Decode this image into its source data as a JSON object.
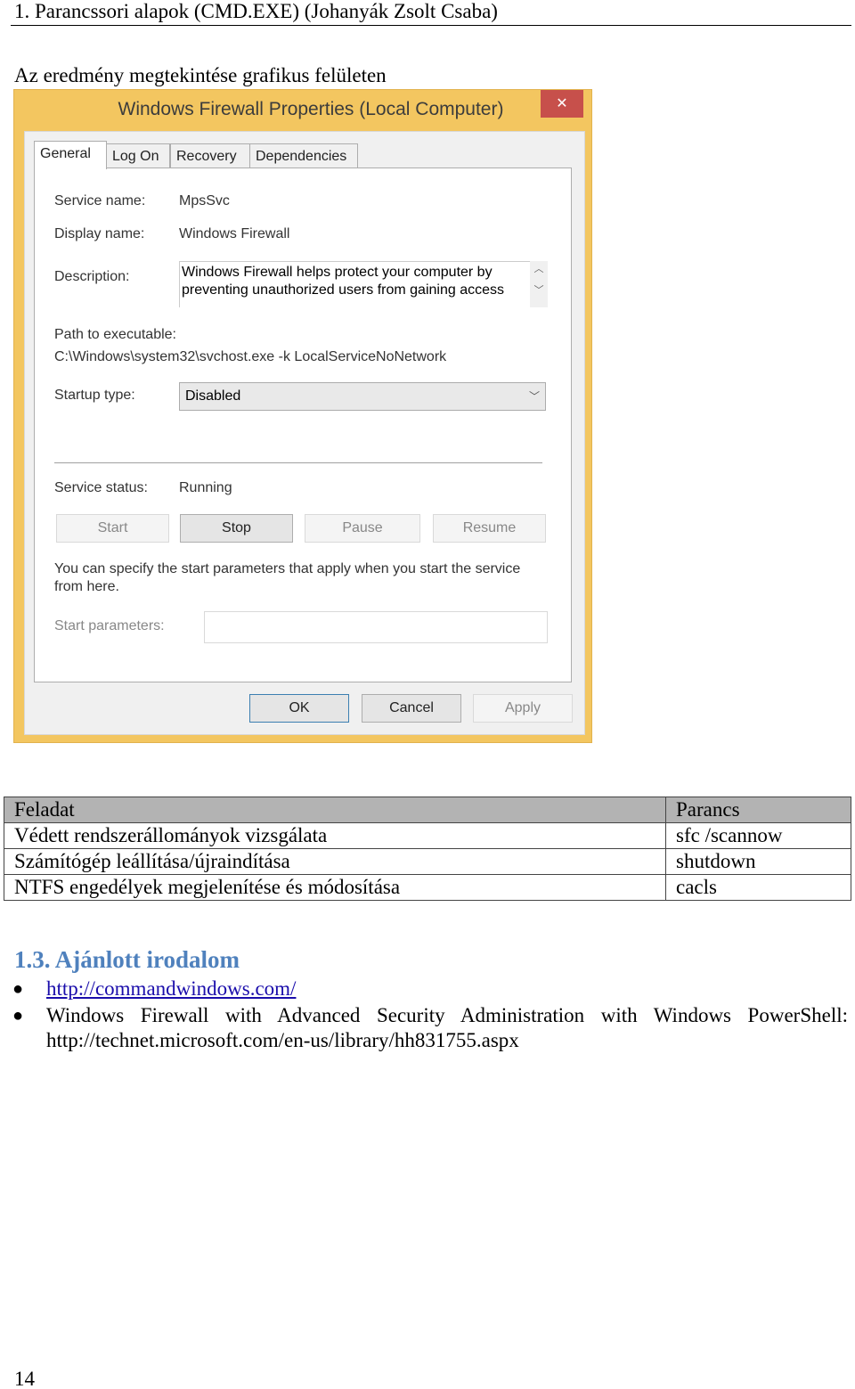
{
  "header": "1. Parancssori alapok (CMD.EXE) (Johanyák Zsolt Csaba)",
  "caption": "Az eredmény megtekintése grafikus felületen",
  "dialog": {
    "title": "Windows Firewall Properties (Local Computer)",
    "close": "✕",
    "tabs": [
      "General",
      "Log On",
      "Recovery",
      "Dependencies"
    ],
    "service_name_label": "Service name:",
    "service_name": "MpsSvc",
    "display_name_label": "Display name:",
    "display_name": "Windows Firewall",
    "description_label": "Description:",
    "description": "Windows Firewall helps protect your computer by preventing unauthorized users from gaining access",
    "path_label": "Path to executable:",
    "path": "C:\\Windows\\system32\\svchost.exe -k LocalServiceNoNetwork",
    "startup_label": "Startup type:",
    "startup_value": "Disabled",
    "status_label": "Service status:",
    "status_value": "Running",
    "buttons": {
      "start": "Start",
      "stop": "Stop",
      "pause": "Pause",
      "resume": "Resume"
    },
    "hint": "You can specify the start parameters that apply when you start the service from here.",
    "params_label": "Start parameters:",
    "params_value": "",
    "ok": "OK",
    "cancel": "Cancel",
    "apply": "Apply"
  },
  "table": {
    "headers": [
      "Feladat",
      "Parancs"
    ],
    "rows": [
      [
        "Védett rendszerállományok vizsgálata",
        "sfc /scannow"
      ],
      [
        "Számítógép leállítása/újraindítása",
        "shutdown"
      ],
      [
        "NTFS engedélyek megjelenítése és módosítása",
        "cacls"
      ]
    ]
  },
  "section": {
    "title": "1.3. Ajánlott irodalom",
    "items": [
      {
        "link": "http://commandwindows.com/"
      },
      {
        "text": "Windows Firewall with Advanced Security Administration with Windows PowerShell:",
        "url": "http://technet.microsoft.com/en-us/library/hh831755.aspx"
      }
    ]
  },
  "page_number": "14"
}
